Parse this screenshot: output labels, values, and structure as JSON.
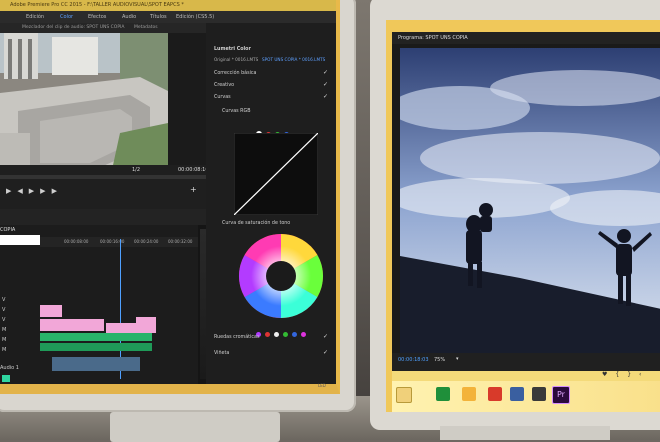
{
  "left_monitor": {
    "title_bar": "Adobe Premiere Pro CC 2015 - F:\\TALLER AUDIOVISUAL\\SPOT EAPCS *",
    "workspace_tabs": [
      "Edición",
      "Color",
      "Efectos",
      "Audio",
      "Títulos",
      "Edición (CS5.5)"
    ],
    "active_workspace": "Color",
    "source_panel_tabs": [
      "Mezclador del clip de audio: SPOT UNS COPIA",
      "Metadatos"
    ],
    "source_timecode_fraction": "1/2",
    "source_timecode": "00:00:08:16",
    "lumetri": {
      "title": "Lumetri Color",
      "clip_selector": "Original * 0016.LMTS",
      "sequence_selector": "SPOT UNS COPIA * 0016.LMTS",
      "sections": [
        "Corrección básica",
        "Creativo",
        "Curvas"
      ],
      "rgb_curves_label": "Curvas RGB",
      "hue_sat_label": "Curva de saturación de tono",
      "wheels_label": "Ruedas cromáticas",
      "vignette_label": "Viñeta"
    },
    "timeline": {
      "sequence_name": "COPIA",
      "timecodes": [
        "00:00:08:00",
        "00:00:16:00",
        "00:00:24:00",
        "00:00:32:00"
      ],
      "track_label": "Audio 1"
    },
    "bezel_text": "LED"
  },
  "right_monitor": {
    "program_title": "Programa: SPOT UNS COPIA",
    "program_timecode": "00:00:18:03",
    "zoom_level": "75%",
    "taskbar_icons": [
      "file-explorer-icon",
      "excel-icon",
      "folder-icon",
      "media-icon",
      "image-icon",
      "display-icon",
      "premiere-icon"
    ],
    "premiere_label": "Pr"
  },
  "colors": {
    "accent_yellow": "#f0c85a",
    "active_blue": "#5ea0ff",
    "premiere_purple": "#2a0a3c"
  }
}
